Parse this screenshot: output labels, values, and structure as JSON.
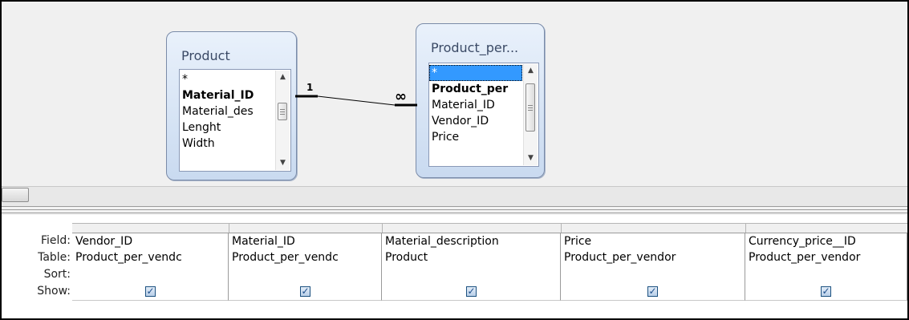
{
  "relationship_diagram": {
    "tables": [
      {
        "title": "Product",
        "fields": [
          {
            "name": "*",
            "style": "normal"
          },
          {
            "name": "Material_ID",
            "style": "bold"
          },
          {
            "name": "Material_des",
            "style": "normal"
          },
          {
            "name": "Lenght",
            "style": "normal"
          },
          {
            "name": "Width",
            "style": "normal"
          }
        ]
      },
      {
        "title": "Product_per...",
        "fields": [
          {
            "name": "*",
            "style": "selected"
          },
          {
            "name": "Product_per",
            "style": "bold"
          },
          {
            "name": "Material_ID",
            "style": "normal"
          },
          {
            "name": "Vendor_ID",
            "style": "normal"
          },
          {
            "name": "Price",
            "style": "normal"
          }
        ]
      }
    ],
    "relationship": {
      "one_label": "1",
      "many_label": "∞"
    }
  },
  "query_grid": {
    "row_labels": [
      "Field:",
      "Table:",
      "Sort:",
      "Show:"
    ],
    "columns": [
      {
        "field": "Vendor_ID",
        "table": "Product_per_vendc",
        "sort": "",
        "show": true
      },
      {
        "field": "Material_ID",
        "table": "Product_per_vendc",
        "sort": "",
        "show": true
      },
      {
        "field": "Material_description",
        "table": "Product",
        "sort": "",
        "show": true
      },
      {
        "field": "Price",
        "table": "Product_per_vendor",
        "sort": "",
        "show": true
      },
      {
        "field": "Currency_price__ID",
        "table": "Product_per_vendor",
        "sort": "",
        "show": true
      }
    ]
  },
  "icons": {
    "scroll_up": "chevron-up-icon",
    "scroll_down": "chevron-down-icon",
    "checkbox": "check-icon",
    "check_glyph": "✓"
  }
}
